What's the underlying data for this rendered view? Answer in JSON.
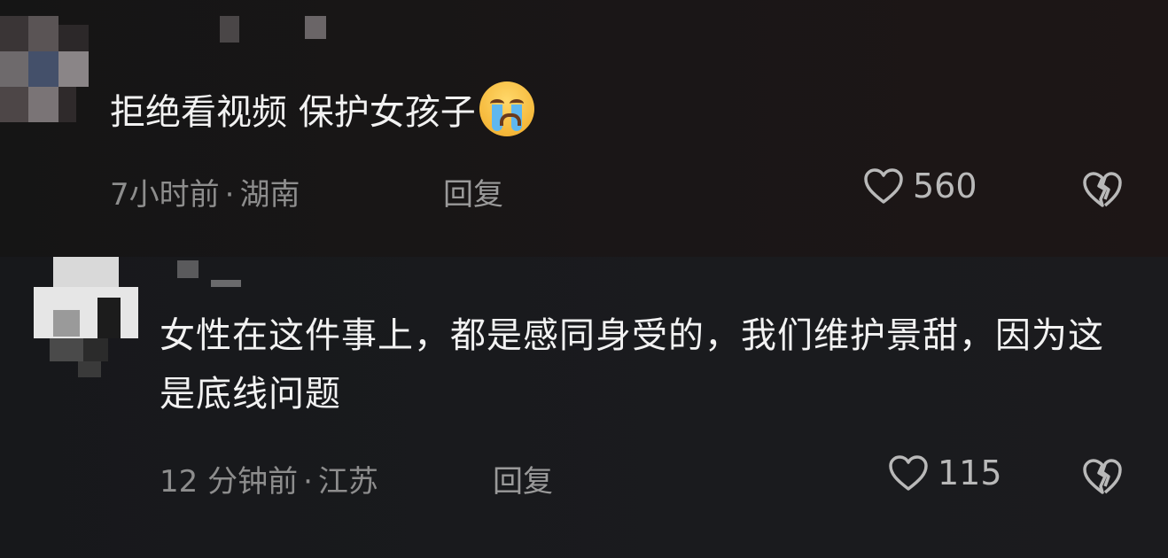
{
  "comments": [
    {
      "text": "拒绝看视频 保护女孩子",
      "emoji": "crying-face-emoji",
      "time": "7小时前",
      "separator": "·",
      "location": "湖南",
      "reply_label": "回复",
      "likes": "560"
    },
    {
      "text": "女性在这件事上，都是感同身受的，我们维护景甜，因为这是底线问题",
      "time": "12 分钟前",
      "separator": "·",
      "location": "江苏",
      "reply_label": "回复",
      "likes": "115"
    }
  ],
  "colors": {
    "text": "#f2f2f2",
    "meta": "#8d8d8d",
    "icon": "#b9b9b9"
  }
}
